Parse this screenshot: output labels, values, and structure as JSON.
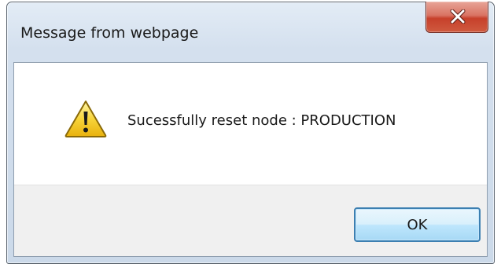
{
  "dialog": {
    "title": "Message from webpage",
    "message": "Sucessfully reset node : PRODUCTION",
    "ok_label": "OK",
    "icon": "warning-icon"
  },
  "colors": {
    "close_button": "#c7402b",
    "ok_border": "#3c7fb1",
    "warning_fill": "#f5c518"
  }
}
